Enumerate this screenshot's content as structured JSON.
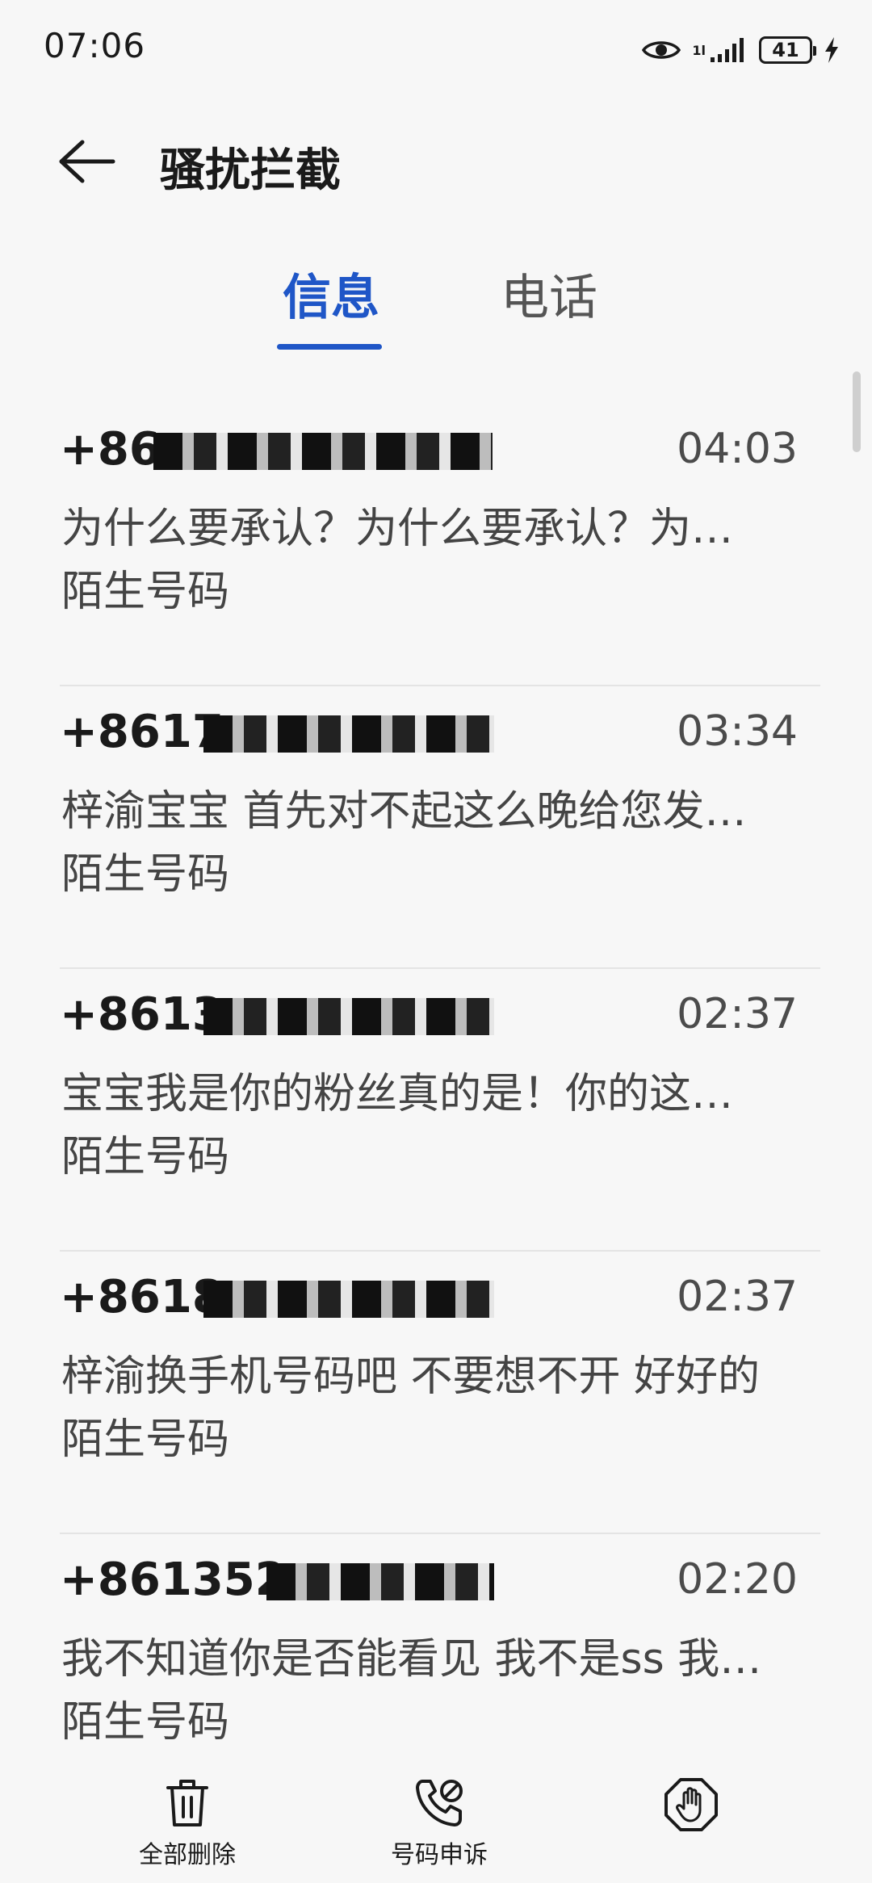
{
  "status_bar": {
    "time": "07:06",
    "network": "1l",
    "battery": "41"
  },
  "header": {
    "title": "骚扰拦截"
  },
  "tabs": [
    {
      "label": "信息",
      "active": true
    },
    {
      "label": "电话",
      "active": false
    }
  ],
  "messages": [
    {
      "number": "+86",
      "time": "04:03",
      "preview": "为什么要承认？为什么要承认？为…",
      "tag": "陌生号码"
    },
    {
      "number": "+8617",
      "time": "03:34",
      "preview": "梓渝宝宝 首先对不起这么晚给您发…",
      "tag": "陌生号码"
    },
    {
      "number": "+8613",
      "time": "02:37",
      "preview": "宝宝我是你的粉丝真的是！你的这…",
      "tag": "陌生号码"
    },
    {
      "number": "+8618",
      "time": "02:37",
      "preview": "梓渝换手机号码吧 不要想不开 好好的",
      "tag": "陌生号码"
    },
    {
      "number": "+861352",
      "time": "02:20",
      "preview": "我不知道你是否能看见 我不是ss 我…",
      "tag": "陌生号码"
    }
  ],
  "toolbar": {
    "delete_all": "全部删除",
    "appeal": "号码申诉"
  },
  "colors": {
    "accent": "#1f56c7",
    "background": "#f7f7f7"
  }
}
